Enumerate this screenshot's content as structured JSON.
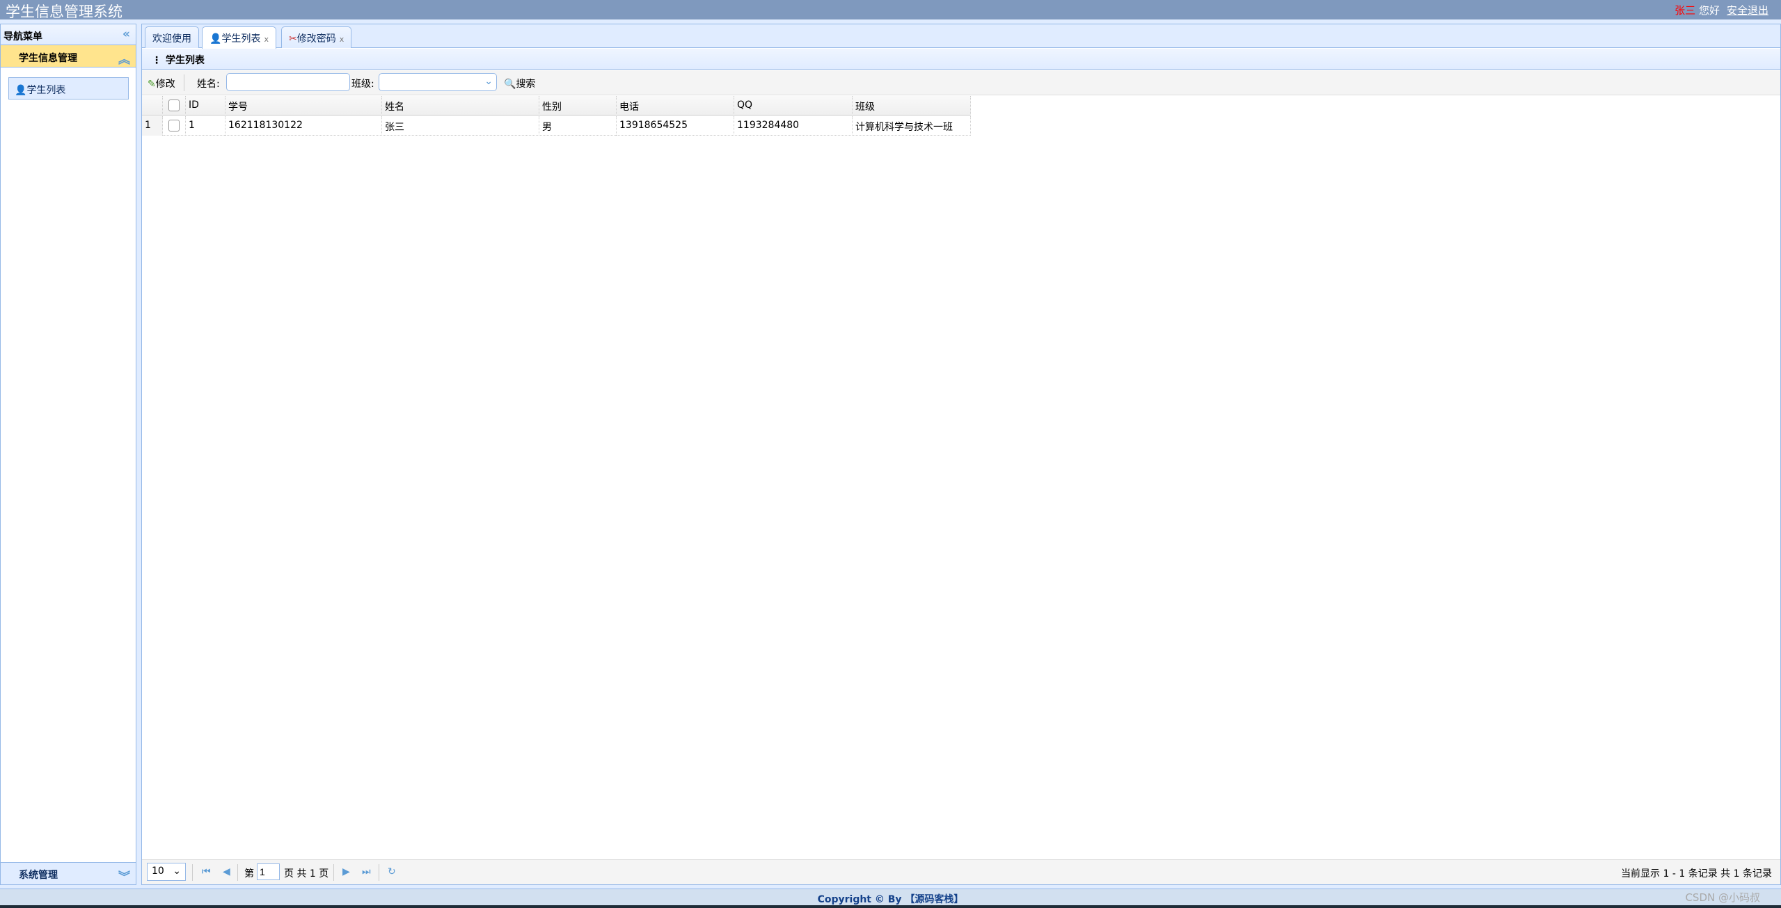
{
  "app": {
    "title": "学生信息管理系统",
    "user": "张三",
    "greeting": "您好",
    "logout": "安全退出"
  },
  "sidebar": {
    "header": "导航菜单",
    "groups": [
      {
        "label": "学生信息管理",
        "items": [
          {
            "label": "学生列表",
            "icon": "user-icon"
          }
        ]
      },
      {
        "label": "系统管理"
      }
    ]
  },
  "tabs": [
    {
      "label": "欢迎使用"
    },
    {
      "label": "学生列表",
      "icon": "user-icon",
      "closable": true
    },
    {
      "label": "修改密码",
      "icon": "tools-icon",
      "closable": true
    }
  ],
  "close_glyph": "x",
  "panel": {
    "title": "学生列表"
  },
  "toolbar": {
    "edit": "修改",
    "name_label": "姓名:",
    "name_value": "",
    "class_label": "班级:",
    "class_value": "",
    "search": "搜索"
  },
  "grid": {
    "columns": [
      "ID",
      "学号",
      "姓名",
      "性别",
      "电话",
      "QQ",
      "班级"
    ],
    "rows": [
      {
        "rownum": "1",
        "cells": [
          "1",
          "162118130122",
          "张三",
          "男",
          "13918654525",
          "1193284480",
          "计算机科学与技术一班"
        ]
      }
    ]
  },
  "pager": {
    "page_size": "10",
    "page_prefix": "第",
    "page": "1",
    "page_suffix": "页 共 1 页",
    "info": "当前显示 1 - 1 条记录 共 1 条记录"
  },
  "footer": "Copyright © By 【源码客栈】",
  "watermark": "CSDN @小码叔"
}
